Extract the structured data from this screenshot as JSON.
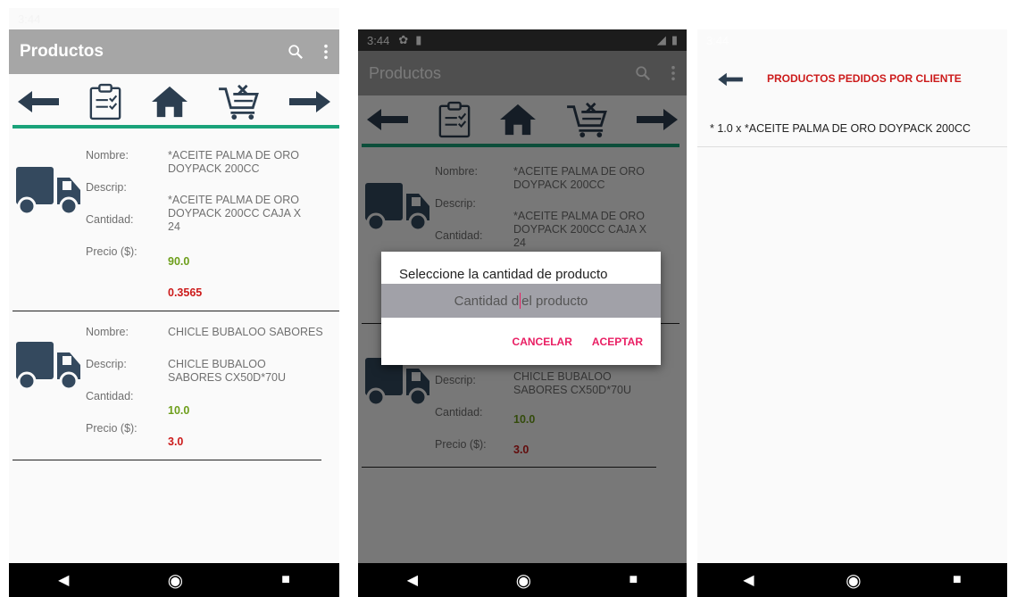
{
  "app": {
    "title": "Productos",
    "time": "3:44"
  },
  "icons": {
    "search": "search-icon",
    "more": "more-vert-icon",
    "back": "arrow-left-icon",
    "orders": "clipboard-icon",
    "home": "home-icon",
    "cart": "cart-remove-icon",
    "forward": "arrow-right-icon",
    "truck": "truck-icon"
  },
  "colors": {
    "appbar": "#a6a6a6",
    "accent_line": "#1aa37a",
    "quantity": "#6d9e1a",
    "price": "#cc1b1b",
    "dialog_button": "#e91e63",
    "icon_dark": "#2c3e50"
  },
  "labels": {
    "nombre": "Nombre:",
    "descrip": "Descrip:",
    "cantidad": "Cantidad:",
    "precio": "Precio ($):"
  },
  "products": [
    {
      "nombre": "*ACEITE PALMA DE ORO DOYPACK 200CC",
      "descrip": "*ACEITE PALMA DE ORO DOYPACK 200CC CAJA X 24",
      "cantidad": "90.0",
      "precio": "0.3565"
    },
    {
      "nombre": "CHICLE BUBALOO SABORES",
      "descrip": "CHICLE BUBALOO SABORES CX50D*70U",
      "cantidad": "10.0",
      "precio": "3.0"
    }
  ],
  "dialog": {
    "title": "Seleccione la cantidad de producto",
    "placeholder_before": "Cantidad d",
    "placeholder_after": "el producto",
    "cancel": "CANCELAR",
    "accept": "ACEPTAR"
  },
  "orders_screen": {
    "title": "PRODUCTOS PEDIDOS POR CLIENTE",
    "line": "* 1.0 x *ACEITE PALMA DE ORO DOYPACK 200CC"
  }
}
